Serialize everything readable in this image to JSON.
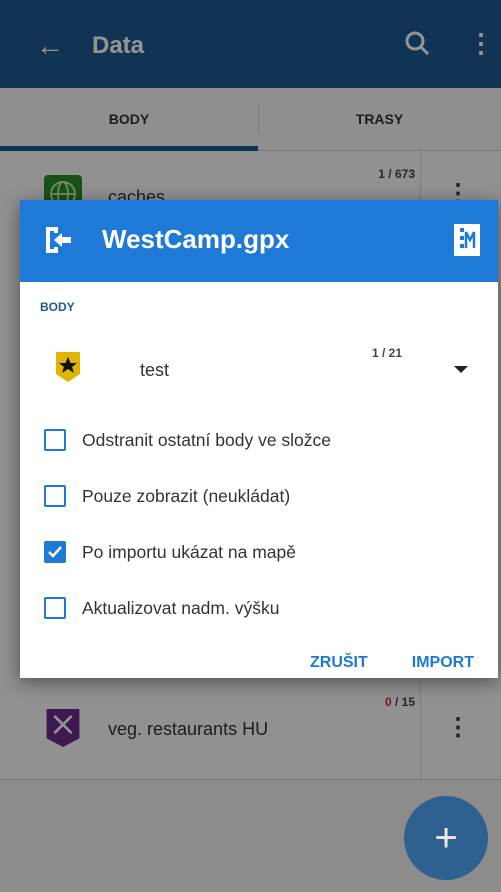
{
  "toolbar": {
    "title": "Data",
    "back_icon": "arrow-back-icon",
    "search_icon": "search-icon",
    "more_icon": "more-vert-icon"
  },
  "tabs": [
    {
      "label": "BODY",
      "active": true
    },
    {
      "label": "TRASY",
      "active": false
    }
  ],
  "list": {
    "items": [
      {
        "name": "caches",
        "count": "1 / 673",
        "icon": "globe-icon"
      },
      {
        "name": "veg. restaurants HU",
        "count_selected": "0",
        "count_total": "/ 15",
        "icon": "restaurant-icon"
      }
    ]
  },
  "dialog": {
    "title": "WestCamp.gpx",
    "section_label": "BODY",
    "folder_value": "test",
    "folder_count": "1 / 21",
    "options": [
      {
        "label": "Odstranit ostatní body ve složce",
        "checked": false
      },
      {
        "label": "Pouze zobrazit (neukládat)",
        "checked": false
      },
      {
        "label": "Po importu ukázat na mapě",
        "checked": true
      },
      {
        "label": "Aktualizovat nadm. výšku",
        "checked": false
      }
    ],
    "cancel_label": "ZRUŠIT",
    "import_label": "IMPORT"
  },
  "fab": {
    "label": "+"
  },
  "colors": {
    "toolbar": "#1e5a91",
    "dialog_header": "#1e7ad6",
    "accent": "#1e7ad6"
  }
}
